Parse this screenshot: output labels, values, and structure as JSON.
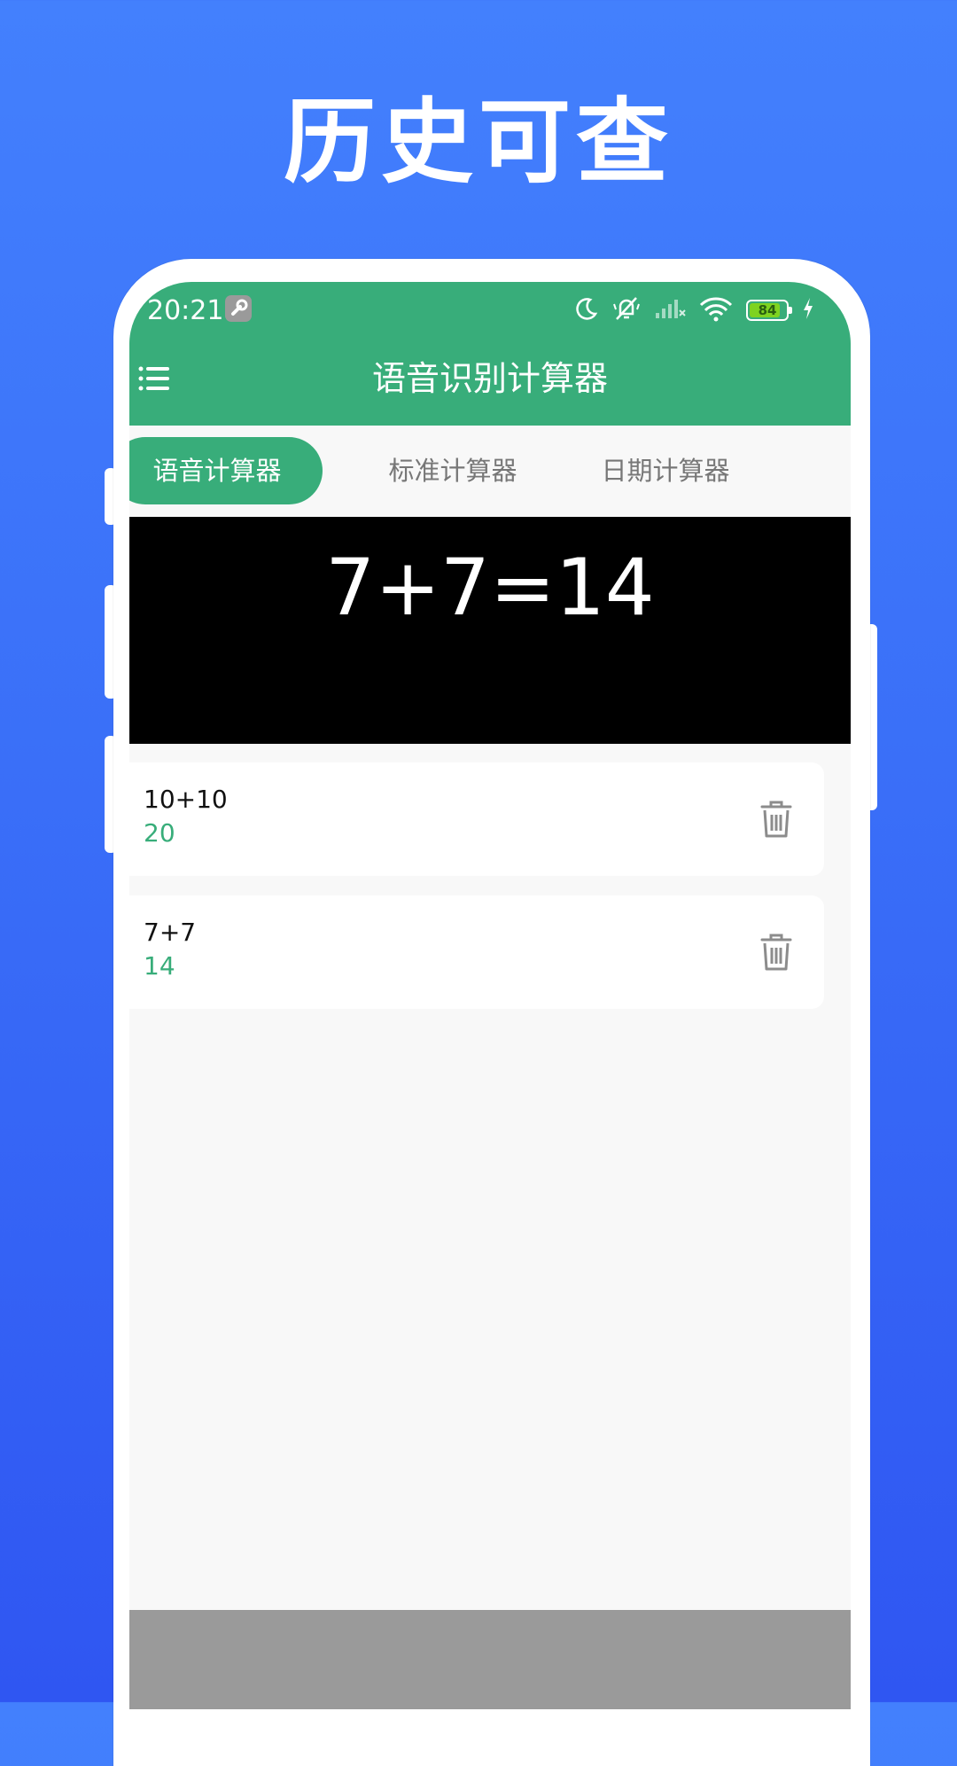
{
  "headline": "历史可查",
  "status_bar": {
    "time": "20:21",
    "battery": "84",
    "battery_color": "#7ed321"
  },
  "app_bar": {
    "title": "语音识别计算器",
    "color": "#38ad7a",
    "menu_icon": "menu-icon"
  },
  "tabs": [
    {
      "label": "语音计算器",
      "active": true
    },
    {
      "label": "标准计算器",
      "active": false
    },
    {
      "label": "日期计算器",
      "active": false
    }
  ],
  "display": {
    "text": "7+7=14"
  },
  "history": [
    {
      "expression": "10+10",
      "result": "20",
      "icon": "trash-icon"
    },
    {
      "expression": "7+7",
      "result": "14",
      "icon": "trash-icon"
    }
  ]
}
